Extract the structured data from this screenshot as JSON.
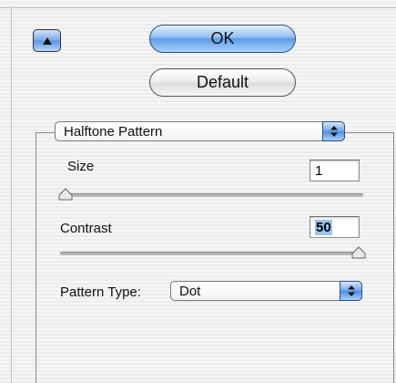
{
  "buttons": {
    "ok_label": "OK",
    "default_label": "Default"
  },
  "halftone": {
    "mode_selected": "Halftone Pattern",
    "size_label": "Size",
    "size_value": "1",
    "size_fraction": 0.0,
    "contrast_label": "Contrast",
    "contrast_value": "50",
    "contrast_fraction": 1.0,
    "pattern_type_label": "Pattern Type:",
    "pattern_type_selected": "Dot"
  },
  "icons": {
    "collapse": "up-triangle-icon",
    "popup_arrows": "up-down-arrows-icon",
    "slider_thumb": "slider-thumb-icon"
  },
  "colors": {
    "accent_blue": "#5d9be6"
  }
}
